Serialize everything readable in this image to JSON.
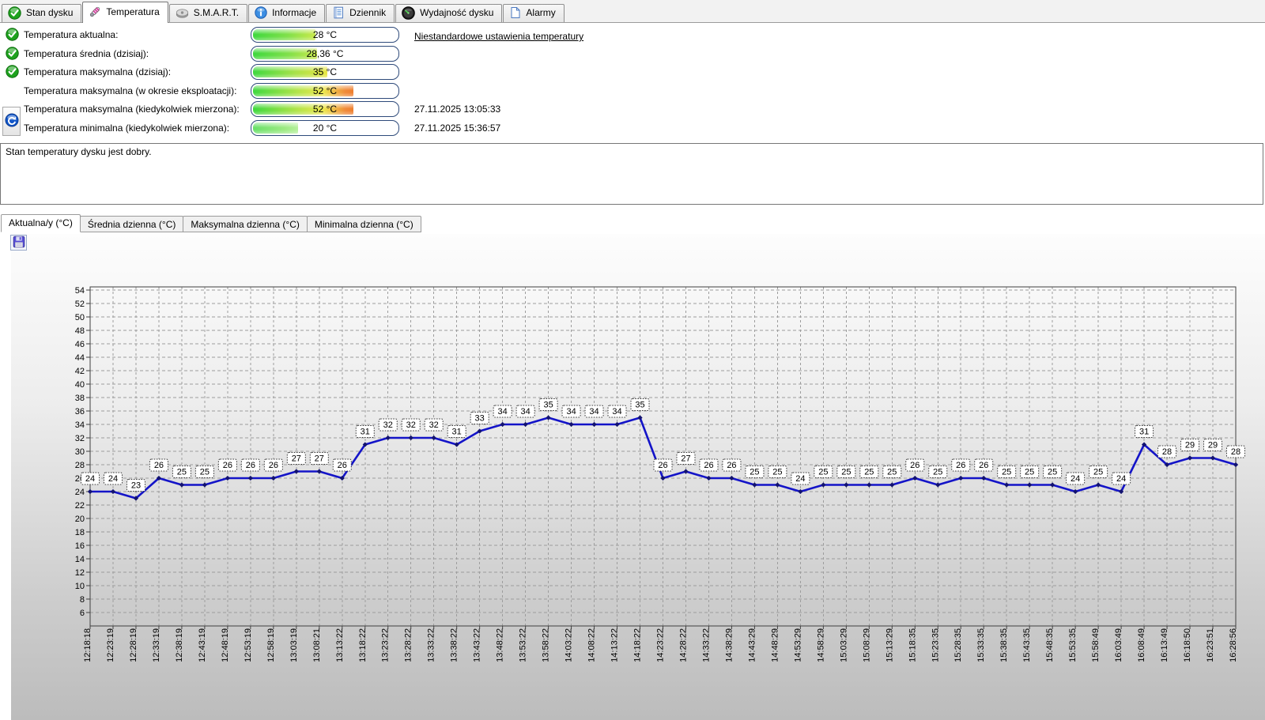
{
  "main_tabs": [
    {
      "label": "Stan dysku",
      "icon": "disk-status-icon",
      "active": false
    },
    {
      "label": "Temperatura",
      "icon": "temperature-icon",
      "active": true
    },
    {
      "label": "S.M.A.R.T.",
      "icon": "smart-icon",
      "active": false
    },
    {
      "label": "Informacje",
      "icon": "info-icon",
      "active": false
    },
    {
      "label": "Dziennik",
      "icon": "journal-icon",
      "active": false
    },
    {
      "label": "Wydajność dysku",
      "icon": "performance-icon",
      "active": false
    },
    {
      "label": "Alarmy",
      "icon": "alarms-icon",
      "active": false
    }
  ],
  "temperature_rows": [
    {
      "label": "Temperatura aktualna:",
      "value": "28 °C",
      "fill_pct": 43,
      "bar_type": "normal",
      "status_icon": true,
      "date": ""
    },
    {
      "label": "Temperatura średnia (dzisiaj):",
      "value": "28,36 °C",
      "fill_pct": 44,
      "bar_type": "normal",
      "status_icon": true,
      "date": ""
    },
    {
      "label": "Temperatura maksymalna (dzisiaj):",
      "value": "35 °C",
      "fill_pct": 51,
      "bar_type": "warm",
      "status_icon": true,
      "date": ""
    },
    {
      "label": "Temperatura maksymalna (w okresie eksploatacji):",
      "value": "52 °C",
      "fill_pct": 69,
      "bar_type": "hot",
      "status_icon": false,
      "date": ""
    },
    {
      "label": "Temperatura maksymalna (kiedykolwiek mierzona):",
      "value": "52 °C",
      "fill_pct": 69,
      "bar_type": "hot",
      "status_icon": false,
      "date": "27.11.2025 13:05:33"
    },
    {
      "label": "Temperatura minimalna (kiedykolwiek mierzona):",
      "value": "20 °C",
      "fill_pct": 31,
      "bar_type": "cool",
      "status_icon": false,
      "date": "27.11.2025 15:36:57"
    }
  ],
  "link_label": "Niestandardowe ustawienia temperatury",
  "status_text": "Stan temperatury dysku jest dobry.",
  "chart_tabs": [
    {
      "label": "Aktualna/y (°C)",
      "active": true
    },
    {
      "label": "Średnia dzienna (°C)",
      "active": false
    },
    {
      "label": "Maksymalna dzienna (°C)",
      "active": false
    },
    {
      "label": "Minimalna dzienna (°C)",
      "active": false
    }
  ],
  "colors": {
    "line": "#1414c8",
    "marker": "#131370",
    "grid": "#9d9d9d",
    "plot_border": "#404040",
    "bar_border": "#2e4a7a"
  },
  "chart_data": {
    "type": "line",
    "title": "",
    "xlabel": "",
    "ylabel": "",
    "grid": true,
    "legend": "none",
    "ylim": [
      4,
      54.5
    ],
    "ytick_max": 54,
    "ytick_min": 6,
    "ytick_step": 2,
    "point_labels": true,
    "x": [
      "12:18:18",
      "12:23:19",
      "12:28:19",
      "12:33:19",
      "12:38:19",
      "12:43:19",
      "12:48:19",
      "12:53:19",
      "12:58:19",
      "13:03:19",
      "13:08:21",
      "13:13:22",
      "13:18:22",
      "13:23:22",
      "13:28:22",
      "13:33:22",
      "13:38:22",
      "13:43:22",
      "13:48:22",
      "13:53:22",
      "13:58:22",
      "14:03:22",
      "14:08:22",
      "14:13:22",
      "14:18:22",
      "14:23:22",
      "14:28:22",
      "14:33:22",
      "14:38:29",
      "14:43:29",
      "14:48:29",
      "14:53:29",
      "14:58:29",
      "15:03:29",
      "15:08:29",
      "15:13:29",
      "15:18:35",
      "15:23:35",
      "15:28:35",
      "15:33:35",
      "15:38:35",
      "15:43:35",
      "15:48:35",
      "15:53:35",
      "15:58:49",
      "16:03:49",
      "16:08:49",
      "16:13:49",
      "16:18:50",
      "16:23:51",
      "16:28:56"
    ],
    "values": [
      24,
      24,
      23,
      26,
      25,
      25,
      26,
      26,
      26,
      27,
      27,
      26,
      31,
      32,
      32,
      32,
      31,
      33,
      34,
      34,
      35,
      34,
      34,
      34,
      35,
      26,
      27,
      26,
      26,
      25,
      25,
      24,
      25,
      25,
      25,
      25,
      26,
      25,
      26,
      26,
      25,
      25,
      25,
      24,
      25,
      24,
      31,
      28,
      29,
      29,
      28
    ]
  }
}
